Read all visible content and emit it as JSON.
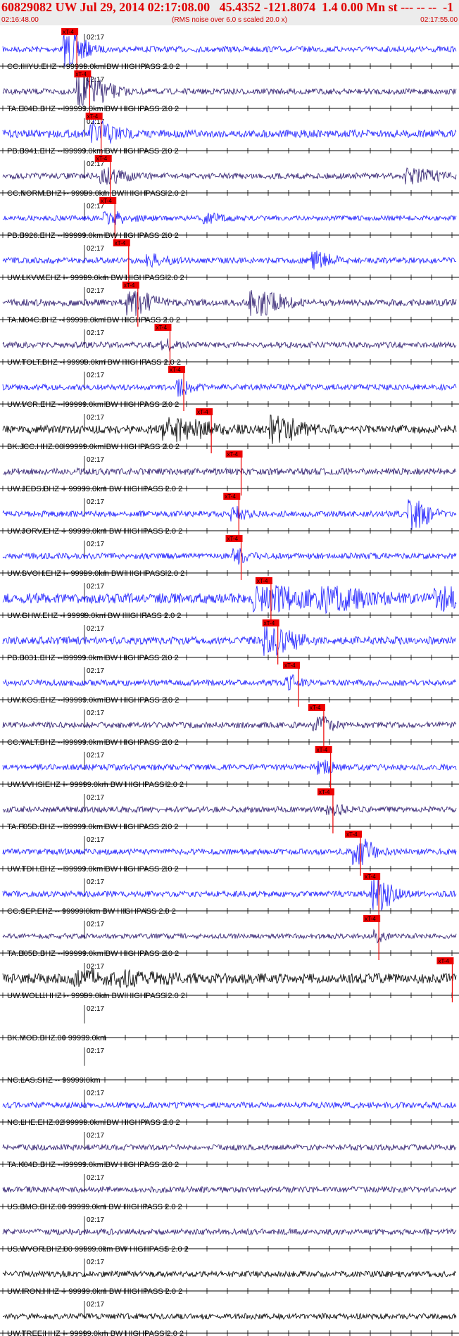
{
  "header": {
    "title": "60829082 UW Jul 29, 2014 02:17:08.00   45.4352 -121.8074  1.4 0.00 Mn st --- -- --  -1",
    "start_time": "02:16:48.00",
    "end_time": "02:17:55.00",
    "rms_note": "(RMS noise over 6.0 s scaled 20.0 x)"
  },
  "pick_label": "xT-4",
  "minute_label": "02:17",
  "colors": {
    "blue": "#1a1aff",
    "purple": "#2d1b6e",
    "black": "#000000",
    "pick": "#ee0000",
    "header_text": "#e00000"
  },
  "traces": [
    {
      "label": "CC.HIYU.EHZ -- 99999.0km BW  HIGHPASS  2.0  2",
      "color": "blue",
      "pick": 0.152,
      "amp": 0.35,
      "events": [
        [
          0.15,
          1.8,
          0.04
        ]
      ]
    },
    {
      "label": "TA.E04D.BHZ -- 99999.0km BW  HIGHPASS  2.0  2",
      "color": "purple",
      "pick": 0.18,
      "amp": 0.35,
      "events": [
        [
          0.185,
          1.6,
          0.06
        ]
      ]
    },
    {
      "label": "PB.B941.EHZ -- 99999.0km BW  HIGHPASS  2.0  2",
      "color": "blue",
      "pick": 0.205,
      "amp": 0.45,
      "events": [
        [
          0.21,
          1.3,
          0.05
        ]
      ]
    },
    {
      "label": "CC.NORM.BHZ -- 99999.0km BW  HIGHPASS  2.0  2",
      "color": "purple",
      "pick": 0.225,
      "amp": 0.35,
      "events": [
        [
          0.23,
          0.8,
          0.05
        ],
        [
          0.9,
          0.7,
          0.06
        ]
      ]
    },
    {
      "label": "PB.B926.EHZ -- 99999.0km BW  HIGHPASS  2.0  2",
      "color": "blue",
      "pick": 0.235,
      "amp": 0.3,
      "events": [
        [
          0.24,
          0.6,
          0.05
        ],
        [
          0.45,
          0.4,
          0.04
        ]
      ]
    },
    {
      "label": "UW.LKVW.EHZ -- 99999.0km BW  HIGHPASS  2.0  2",
      "color": "blue",
      "pick": 0.265,
      "amp": 0.35,
      "events": [
        [
          0.33,
          0.5,
          0.04
        ],
        [
          0.69,
          0.9,
          0.04
        ]
      ]
    },
    {
      "label": "TA.M04C.BHZ -- 99999.0km BW  HIGHPASS  2.0  2",
      "color": "purple",
      "pick": 0.285,
      "amp": 0.4,
      "events": [
        [
          0.29,
          1.2,
          0.05
        ],
        [
          0.56,
          1.3,
          0.06
        ]
      ]
    },
    {
      "label": "UW.TOLT.BHZ -- 99999.0km BW  HIGHPASS  2.0  2",
      "color": "purple",
      "pick": 0.355,
      "amp": 0.35,
      "events": [
        [
          0.36,
          0.5,
          0.03
        ]
      ]
    },
    {
      "label": "UW.VCR.EHZ -- 99999.0km BW  HIGHPASS  2.0  2",
      "color": "blue",
      "pick": 0.385,
      "amp": 0.35,
      "events": [
        [
          0.39,
          0.8,
          0.03
        ]
      ]
    },
    {
      "label": "BK.JCC.HHZ.00 99999.0km BW  HIGHPASS  2.0  2",
      "color": "black",
      "pick": 0.445,
      "amp": 0.5,
      "events": [
        [
          0.38,
          1.0,
          0.09
        ],
        [
          0.6,
          1.3,
          0.06
        ]
      ]
    },
    {
      "label": "UW.JEDS.BHZ -- 99999.0km BW  HIGHPASS  2.0  2",
      "color": "purple",
      "pick": 0.51,
      "amp": 0.4,
      "events": []
    },
    {
      "label": "UW.JORV.EHZ -- 99999.0km BW  HIGHPASS  2.0  2",
      "color": "blue",
      "pick": 0.505,
      "amp": 0.35,
      "events": [
        [
          0.51,
          0.6,
          0.03
        ],
        [
          0.9,
          1.6,
          0.04
        ]
      ]
    },
    {
      "label": "UW.SVOH.EHZ -- 99999.0km BW  HIGHPASS  2.0  2",
      "color": "blue",
      "pick": 0.51,
      "amp": 0.35,
      "events": [
        [
          0.515,
          0.7,
          0.03
        ]
      ]
    },
    {
      "label": "UW.GHW.EHZ -- 99999.0km BW  HIGHPASS  2.0  2",
      "color": "blue",
      "pick": 0.575,
      "amp": 0.6,
      "events": [
        [
          0.58,
          1.1,
          0.1
        ],
        [
          0.72,
          1.0,
          0.1
        ],
        [
          0.96,
          1.0,
          0.05
        ]
      ]
    },
    {
      "label": "PB.B031.EHZ -- 99999.0km BW  HIGHPASS  2.0  2",
      "color": "blue",
      "pick": 0.59,
      "amp": 0.45,
      "events": [
        [
          0.59,
          1.5,
          0.06
        ]
      ]
    },
    {
      "label": "UW.KOS.EHZ -- 99999.0km BW  HIGHPASS  2.0  2",
      "color": "blue",
      "pick": 0.635,
      "amp": 0.35,
      "events": [
        [
          0.63,
          0.7,
          0.03
        ]
      ]
    },
    {
      "label": "CC.VALT.BHZ -- 99999.0km BW  HIGHPASS  2.0  2",
      "color": "purple",
      "pick": 0.69,
      "amp": 0.35,
      "events": [
        [
          0.69,
          0.8,
          0.04
        ]
      ]
    },
    {
      "label": "UW.VVHS.EHZ -- 99999.0km BW  HIGHPASS  2.0  2",
      "color": "blue",
      "pick": 0.705,
      "amp": 0.35,
      "events": [
        [
          0.7,
          0.6,
          0.03
        ]
      ]
    },
    {
      "label": "TA.F05D.BHZ -- 99999.0km BW  HIGHPASS  2.0  2",
      "color": "purple",
      "pick": 0.71,
      "amp": 0.35,
      "events": [
        [
          0.72,
          0.6,
          0.03
        ]
      ]
    },
    {
      "label": "UW.TDH.EHZ -- 99999.0km BW  HIGHPASS  2.0  2",
      "color": "blue",
      "pick": 0.77,
      "amp": 0.35,
      "events": [
        [
          0.78,
          1.4,
          0.04
        ]
      ]
    },
    {
      "label": "CC.SEP.EHZ -- 99999.0km BW  HIGHPASS  2.0  2",
      "color": "blue",
      "pick": 0.81,
      "amp": 0.35,
      "events": [
        [
          0.82,
          1.8,
          0.04
        ]
      ]
    },
    {
      "label": "TA.B05D.BHZ -- 99999.0km BW  HIGHPASS  2.0  2",
      "color": "purple",
      "pick": 0.81,
      "amp": 0.3,
      "events": [
        [
          0.82,
          0.5,
          0.02
        ]
      ]
    },
    {
      "label": "UW.WOLL.HHZ -- 99999.0km BW  HIGHPASS  2.0  2",
      "color": "black",
      "pick": 0.97,
      "amp": 0.6,
      "events": [
        [
          0.2,
          0.6,
          0.15
        ]
      ]
    },
    {
      "label": "BK.MOD.BHZ.00 99999.0km",
      "color": "blue",
      "pick": null,
      "amp": 0,
      "events": []
    },
    {
      "label": "NC.LAS.SHZ -- 99999.0km",
      "color": "blue",
      "pick": null,
      "amp": 0,
      "events": []
    },
    {
      "label": "NC.LHE.EHZ.02 99999.0km BW  HIGHPASS  2.0  2",
      "color": "blue",
      "pick": null,
      "amp": 0.35,
      "events": []
    },
    {
      "label": "TA.K04D.BHZ -- 99999.0km BW  HIGHPASS  2.0  2",
      "color": "purple",
      "pick": null,
      "amp": 0.35,
      "events": []
    },
    {
      "label": "US.BMO.BHZ.00 99999.0km BW  HIGHPASS  2.0  2",
      "color": "purple",
      "pick": null,
      "amp": 0.35,
      "events": []
    },
    {
      "label": "US.WVOR.BHZ.00 99999.0km BW  HIGHPASS  2.0  2",
      "color": "purple",
      "pick": null,
      "amp": 0.35,
      "events": []
    },
    {
      "label": "UW.IRON.HHZ -- 99999.0km BW  HIGHPASS  2.0  2",
      "color": "black",
      "pick": null,
      "amp": 0.35,
      "events": []
    },
    {
      "label": "UW.TREE.HHZ -- 99999.0km BW  HIGHPASS  2.0  2",
      "color": "black",
      "pick": null,
      "amp": 0.35,
      "events": []
    }
  ]
}
